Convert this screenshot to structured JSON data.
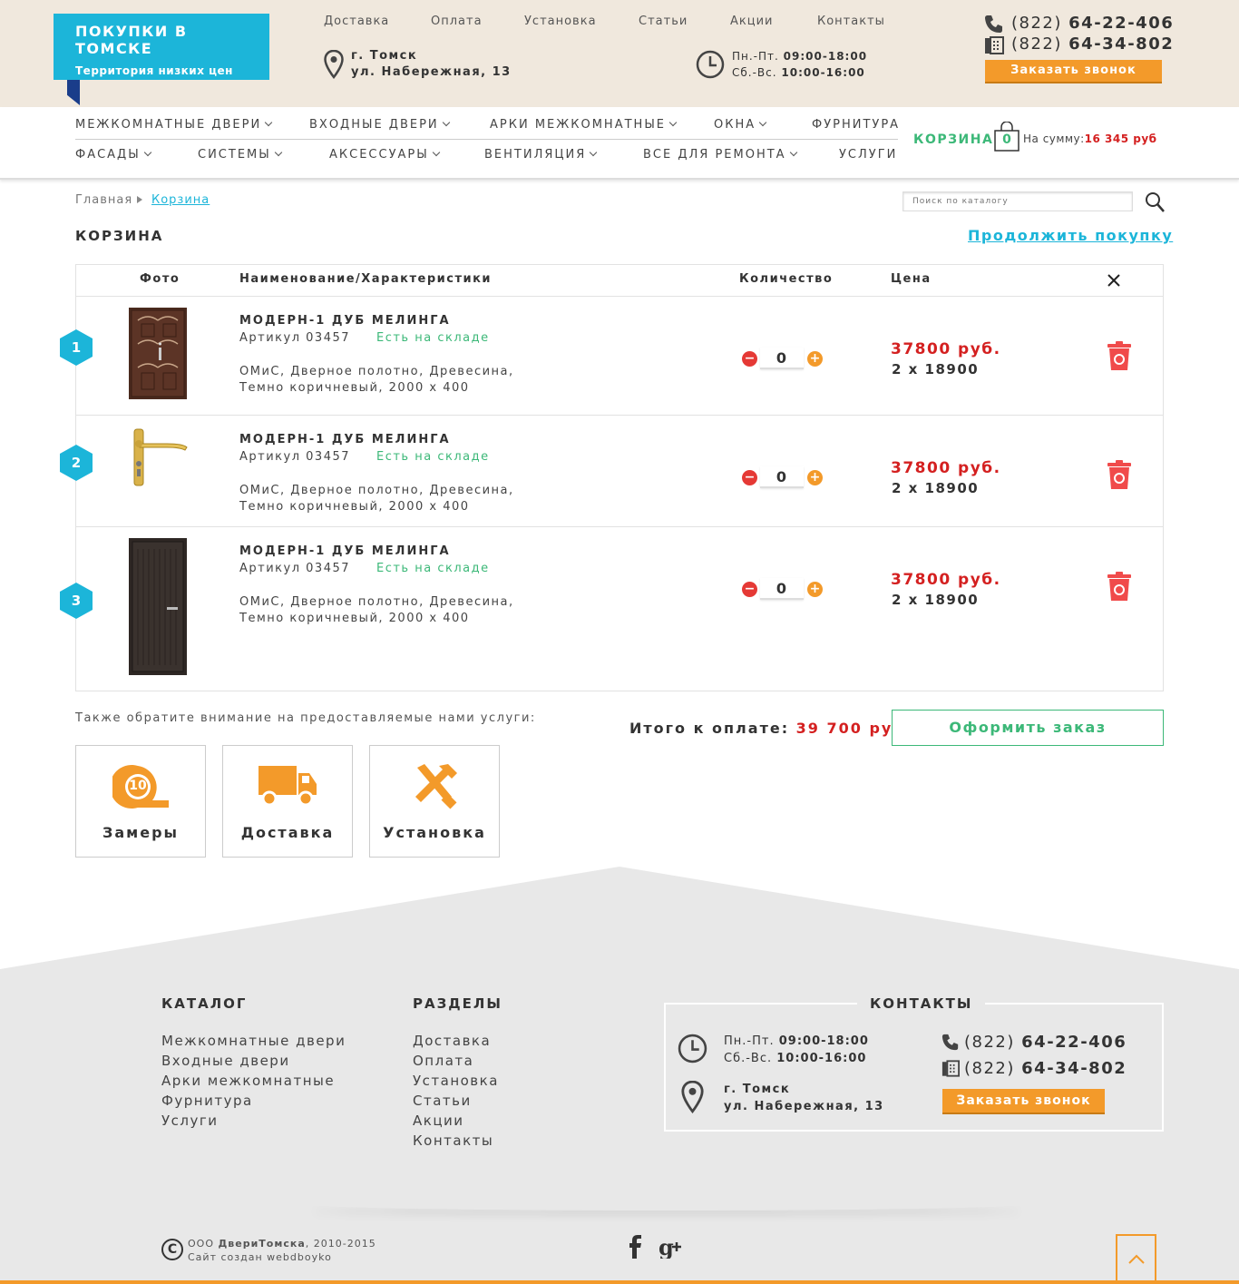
{
  "header": {
    "logo": {
      "title": "ПОКУПКИ В ТОМСКЕ",
      "subtitle": "Территория низких цен"
    },
    "topnav": [
      "Доставка",
      "Оплата",
      "Установка",
      "Статьи",
      "Акции",
      "Контакты"
    ],
    "address": {
      "city": "г. Томск",
      "street": "ул. Набережная, 13"
    },
    "hours": {
      "weekdays_label": "Пн.-Пт.",
      "weekdays": "09:00-18:00",
      "weekend_label": "Сб.-Вс.",
      "weekend": "10:00-16:00"
    },
    "phones": [
      {
        "code": "(822)",
        "number": "64-22-406"
      },
      {
        "code": "(822)",
        "number": "64-34-802"
      }
    ],
    "callback_label": "Заказать звонок"
  },
  "nav": {
    "row1": [
      "МЕЖКОМНАТНЫЕ ДВЕРИ",
      "ВХОДНЫЕ ДВЕРИ",
      "АРКИ МЕЖКОМНАТНЫЕ",
      "ОКНА",
      "ФУРНИТУРА"
    ],
    "row2": [
      "ФАСАДЫ",
      "СИСТЕМЫ",
      "АКСЕССУАРЫ",
      "ВЕНТИЛЯЦИЯ",
      "ВСЕ ДЛЯ РЕМОНТА",
      "УСЛУГИ"
    ],
    "cart_label": "КОРЗИНА",
    "cart_count": "0",
    "cart_sum_label": "На сумму:",
    "cart_sum": "16 345 руб"
  },
  "breadcrumb": {
    "home": "Главная",
    "current": "Корзина"
  },
  "search": {
    "placeholder": "Поиск по каталогу"
  },
  "page": {
    "title": "КОРЗИНА",
    "continue": "Продолжить покупку"
  },
  "table": {
    "headers": {
      "photo": "Фото",
      "name": "Наименование/Характеристики",
      "qty": "Количество",
      "price": "Цена"
    },
    "items": [
      {
        "num": "1",
        "name": "МОДЕРН-1 ДУБ МЕЛИНГА",
        "article": "Артикул 03457",
        "stock": "Есть на складе",
        "desc1": "ОМиС, Дверное полотно, Древесина,",
        "desc2": "Темно коричневый, 2000 х 400",
        "qty": "0",
        "price": "37800 руб.",
        "calc": "2 x 18900"
      },
      {
        "num": "2",
        "name": "МОДЕРН-1 ДУБ МЕЛИНГА",
        "article": "Артикул 03457",
        "stock": "Есть на складе",
        "desc1": "ОМиС, Дверное полотно, Древесина,",
        "desc2": "Темно коричневый, 2000 х 400",
        "qty": "0",
        "price": "37800 руб.",
        "calc": "2 x 18900"
      },
      {
        "num": "3",
        "name": "МОДЕРН-1 ДУБ МЕЛИНГА",
        "article": "Артикул 03457",
        "stock": "Есть на складе",
        "desc1": "ОМиС, Дверное полотно, Древесина,",
        "desc2": "Темно коричневый, 2000 х 400",
        "qty": "0",
        "price": "37800 руб.",
        "calc": "2 x 18900"
      }
    ]
  },
  "summary": {
    "services_label": "Также обратите внимание на предоставляемые нами услуги:",
    "total_label": "Итого к оплате:",
    "total": "39 700 руб.",
    "order_btn": "Оформить заказ"
  },
  "services": [
    {
      "icon": "tape-measure-icon",
      "label": "Замеры",
      "badge": "10"
    },
    {
      "icon": "truck-icon",
      "label": "Доставка"
    },
    {
      "icon": "tools-icon",
      "label": "Установка"
    }
  ],
  "footer": {
    "catalog_title": "КАТАЛОГ",
    "catalog": [
      "Межкомнатные двери",
      "Входные двери",
      "Арки межкомнатные",
      "Фурнитура",
      "Услуги"
    ],
    "sections_title": "РАЗДЕЛЫ",
    "sections": [
      "Доставка",
      "Оплата",
      "Установка",
      "Статьи",
      "Акции",
      "Контакты"
    ],
    "contacts_title": "КОНТАКТЫ",
    "copyright_company": "ООО ДвериТомска",
    "copyright_prefix": "ООО",
    "copyright_name": "ДвериТомска",
    "copyright_years": ", 2010-2015",
    "credits": "Сайт создан webdboyko",
    "social": [
      "facebook-icon",
      "google-plus-icon"
    ]
  },
  "colors": {
    "accent": "#1cb5d9",
    "orange": "#f39a2a",
    "green": "#3cb878",
    "red": "#d42020",
    "beige": "#f0e8dd"
  }
}
